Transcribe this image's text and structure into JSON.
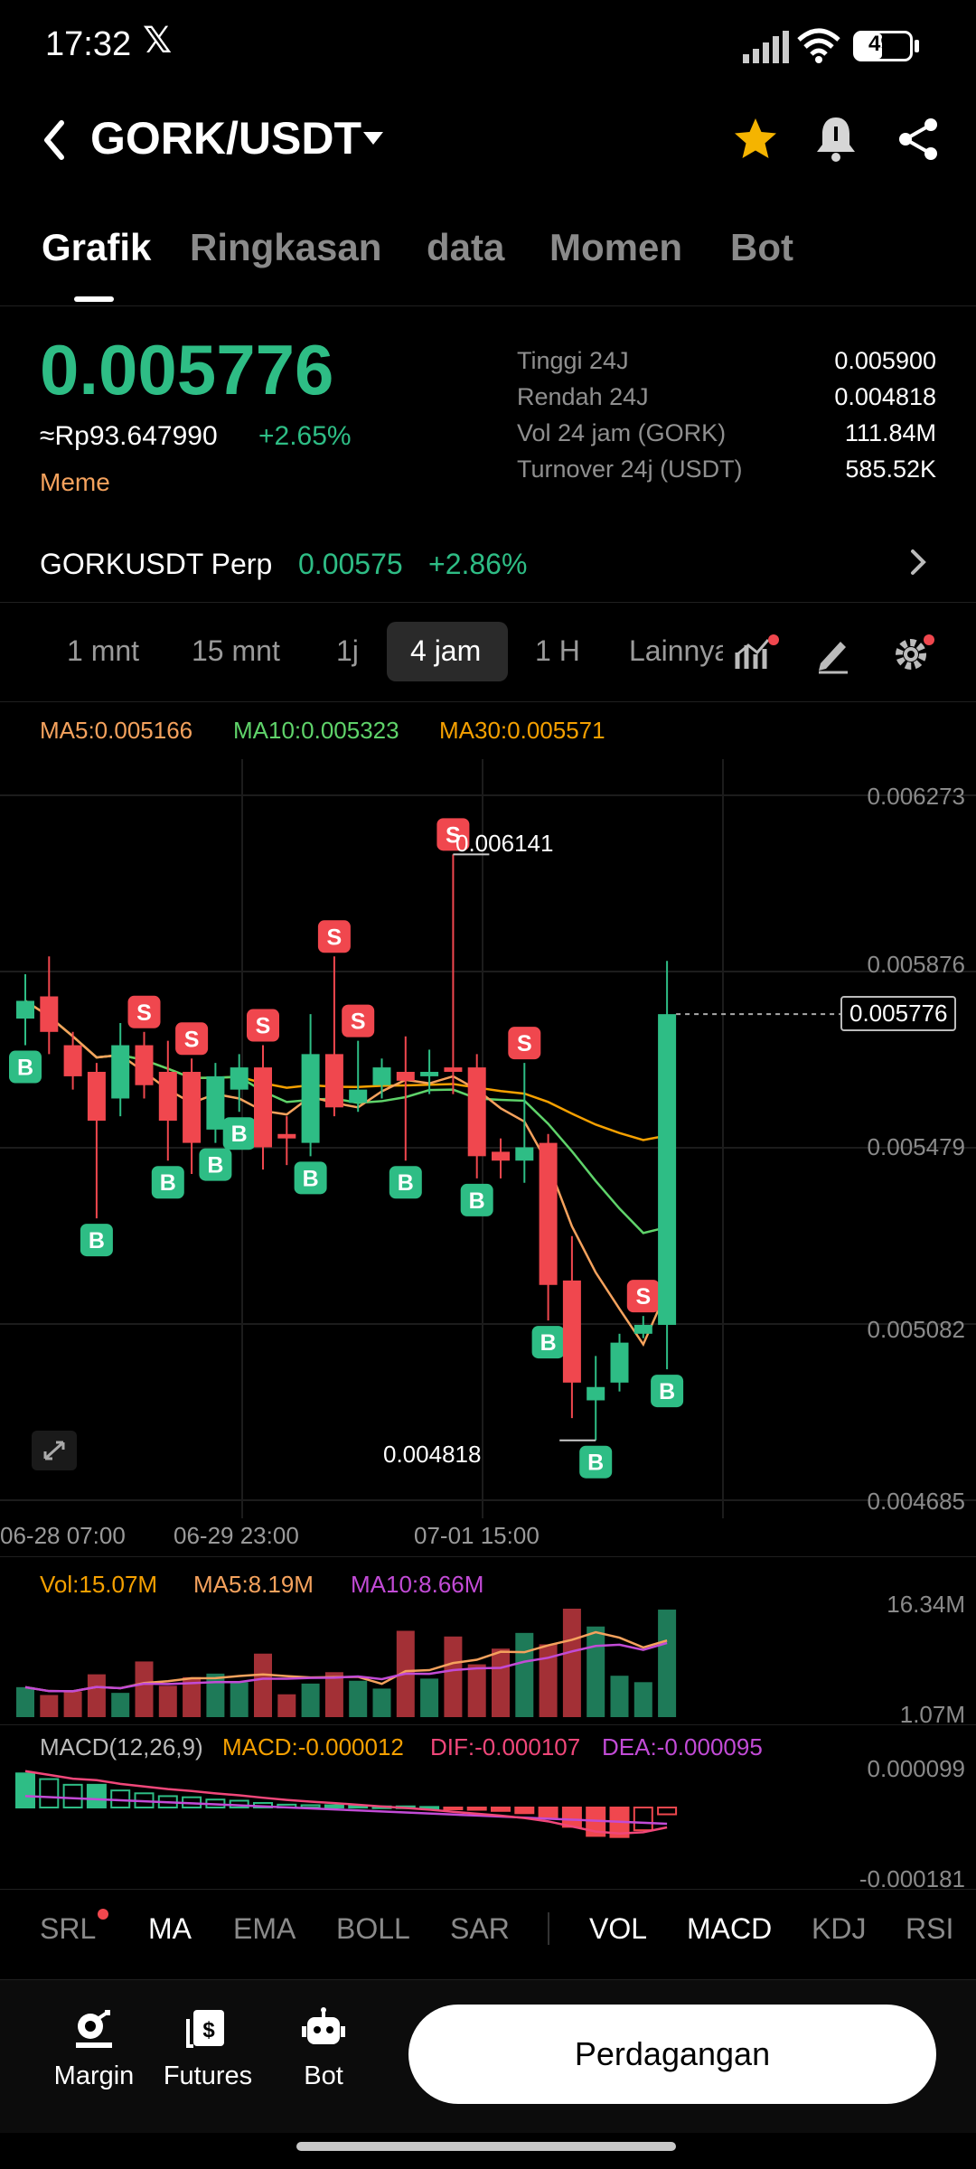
{
  "status_bar": {
    "time": "17:32",
    "x_icon": "x-logo-icon",
    "battery": "49"
  },
  "header": {
    "title": "GORK/USDT",
    "icons": [
      "back-icon",
      "caret-down-icon",
      "star-icon",
      "bell-icon",
      "share-icon"
    ],
    "star_color": "#f5b400"
  },
  "tabs": [
    "Grafik",
    "Ringkasan",
    "data",
    "Momen",
    "Bot"
  ],
  "price": {
    "last": "0.005776",
    "idr": "≈Rp93.647990",
    "change": "+2.65%",
    "tag": "Meme",
    "up_color": "#2ebd85",
    "down_color": "#f0474e"
  },
  "stats": [
    {
      "label": "Tinggi 24J",
      "value": "0.005900"
    },
    {
      "label": "Rendah 24J",
      "value": "0.004818"
    },
    {
      "label": "Vol 24 jam (GORK)",
      "value": "111.84M"
    },
    {
      "label": "Turnover 24j (USDT)",
      "value": "585.52K"
    }
  ],
  "perp": {
    "name": "GORKUSDT Perp",
    "price": "0.00575",
    "change": "+2.86%"
  },
  "timeframes": [
    "1 mnt",
    "15 mnt",
    "1j",
    "4 jam",
    "1 H",
    "Lainnya"
  ],
  "timeframe_selected": "4 jam",
  "ma_legend": {
    "ma5": "MA5:0.005166",
    "ma10": "MA10:0.005323",
    "ma30": "MA30:0.005571"
  },
  "price_axis": [
    "0.006273",
    "0.005876",
    "0.005479",
    "0.005082",
    "0.004685"
  ],
  "current_price_box": "0.005776",
  "high_marker": "0.006141",
  "low_marker": "0.004818",
  "time_axis": [
    "06-28 07:00",
    "06-29 23:00",
    "07-01 15:00"
  ],
  "volume": {
    "vol": "Vol:15.07M",
    "ma5": "MA5:8.19M",
    "ma10": "MA10:8.66M",
    "axis_top": "16.34M",
    "axis_bottom": "1.07M"
  },
  "macd": {
    "label": "MACD(12,26,9)",
    "macd": "MACD:-0.000012",
    "dif": "DIF:-0.000107",
    "dea": "DEA:-0.000095",
    "axis_top": "0.000099",
    "axis_bottom": "-0.000181"
  },
  "indicator_tabs": [
    "SRL",
    "MA",
    "EMA",
    "BOLL",
    "SAR",
    "VOL",
    "MACD",
    "KDJ",
    "RSI"
  ],
  "bottom_nav": [
    {
      "label": "Margin",
      "icon": "margin-icon"
    },
    {
      "label": "Futures",
      "icon": "futures-icon"
    },
    {
      "label": "Bot",
      "icon": "bot-icon"
    }
  ],
  "trade_button": "Perdagangan",
  "chart_data": {
    "type": "candlestick",
    "ylim": [
      0.004685,
      0.006273
    ],
    "candles": [
      {
        "o": 0.00577,
        "c": 0.00581,
        "h": 0.00587,
        "l": 0.00571,
        "s": "B"
      },
      {
        "o": 0.00582,
        "c": 0.00574,
        "h": 0.00591,
        "l": 0.00569
      },
      {
        "o": 0.00571,
        "c": 0.00564,
        "h": 0.00574,
        "l": 0.00561
      },
      {
        "o": 0.00565,
        "c": 0.00554,
        "h": 0.00567,
        "l": 0.00532,
        "s": "B"
      },
      {
        "o": 0.00559,
        "c": 0.00571,
        "h": 0.00576,
        "l": 0.00555
      },
      {
        "o": 0.00571,
        "c": 0.00562,
        "h": 0.00574,
        "l": 0.00559,
        "s": "S"
      },
      {
        "o": 0.00565,
        "c": 0.00554,
        "h": 0.00572,
        "l": 0.00545,
        "s": "B"
      },
      {
        "o": 0.00565,
        "c": 0.00549,
        "h": 0.00568,
        "l": 0.00542,
        "s": "S"
      },
      {
        "o": 0.00552,
        "c": 0.00564,
        "h": 0.00567,
        "l": 0.00549,
        "s": "B"
      },
      {
        "o": 0.00561,
        "c": 0.00566,
        "h": 0.00569,
        "l": 0.00556,
        "s": "B"
      },
      {
        "o": 0.00566,
        "c": 0.00548,
        "h": 0.00571,
        "l": 0.00543,
        "s": "S"
      },
      {
        "o": 0.00551,
        "c": 0.0055,
        "h": 0.00555,
        "l": 0.00544
      },
      {
        "o": 0.00549,
        "c": 0.00569,
        "h": 0.00578,
        "l": 0.00546,
        "s": "B"
      },
      {
        "o": 0.00569,
        "c": 0.00557,
        "h": 0.00591,
        "l": 0.00555,
        "s": "S"
      },
      {
        "o": 0.00558,
        "c": 0.00561,
        "h": 0.00572,
        "l": 0.00556,
        "s": "S"
      },
      {
        "o": 0.00562,
        "c": 0.00566,
        "h": 0.00568,
        "l": 0.00559
      },
      {
        "o": 0.00565,
        "c": 0.00563,
        "h": 0.00573,
        "l": 0.00545,
        "s": "B"
      },
      {
        "o": 0.00564,
        "c": 0.00565,
        "h": 0.0057,
        "l": 0.0056
      },
      {
        "o": 0.00566,
        "c": 0.00565,
        "h": 0.00614,
        "l": 0.0056,
        "s": "S"
      },
      {
        "o": 0.00566,
        "c": 0.00546,
        "h": 0.00569,
        "l": 0.00541,
        "s": "B"
      },
      {
        "o": 0.00547,
        "c": 0.00545,
        "h": 0.0055,
        "l": 0.00541
      },
      {
        "o": 0.00545,
        "c": 0.00548,
        "h": 0.00567,
        "l": 0.0054,
        "s": "S"
      },
      {
        "o": 0.00549,
        "c": 0.00517,
        "h": 0.00551,
        "l": 0.00509,
        "s": "B"
      },
      {
        "o": 0.00518,
        "c": 0.00495,
        "h": 0.00528,
        "l": 0.00487
      },
      {
        "o": 0.00491,
        "c": 0.00494,
        "h": 0.00501,
        "l": 0.00482,
        "s": "B"
      },
      {
        "o": 0.00495,
        "c": 0.00504,
        "h": 0.00506,
        "l": 0.00493
      },
      {
        "o": 0.00506,
        "c": 0.00508,
        "h": 0.0051,
        "l": 0.00505,
        "s": "S"
      },
      {
        "o": 0.00508,
        "c": 0.00578,
        "h": 0.0059,
        "l": 0.00498,
        "s": "B"
      }
    ],
    "volume": [
      4.2,
      3.1,
      3.6,
      6.0,
      3.4,
      7.8,
      4.4,
      5.6,
      6.1,
      4.9,
      8.9,
      3.2,
      4.7,
      6.3,
      5.1,
      4.0,
      12.1,
      5.4,
      11.3,
      7.4,
      9.6,
      11.8,
      10.2,
      15.2,
      12.7,
      5.8,
      4.9,
      15.07
    ],
    "macd_hist": [
      6e-05,
      5e-05,
      4e-05,
      4e-05,
      3e-05,
      2.5e-05,
      2e-05,
      1.8e-05,
      1.4e-05,
      1.2e-05,
      8e-06,
      5e-06,
      4e-06,
      4e-06,
      3e-06,
      2e-06,
      2e-06,
      1e-06,
      -2e-06,
      -4e-06,
      -6e-06,
      -1e-05,
      -1.8e-05,
      -3.4e-05,
      -5e-05,
      -5.2e-05,
      -4e-05,
      -1.2e-05
    ]
  }
}
